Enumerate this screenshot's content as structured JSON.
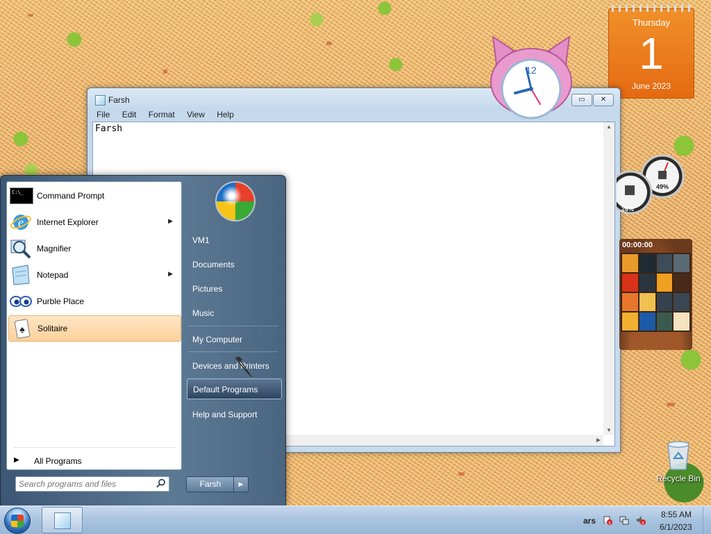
{
  "notepad": {
    "title": "Farsh",
    "menu": [
      "File",
      "Edit",
      "Format",
      "View",
      "Help"
    ],
    "content": "Farsh"
  },
  "start_menu": {
    "programs": [
      {
        "label": "Command Prompt",
        "icon": "command-prompt-icon",
        "has_submenu": false
      },
      {
        "label": "Internet Explorer",
        "icon": "internet-explorer-icon",
        "has_submenu": true
      },
      {
        "label": "Magnifier",
        "icon": "magnifier-icon",
        "has_submenu": false
      },
      {
        "label": "Notepad",
        "icon": "notepad-icon",
        "has_submenu": true
      },
      {
        "label": "Purble Place",
        "icon": "purble-place-icon",
        "has_submenu": false
      },
      {
        "label": "Solitaire",
        "icon": "solitaire-icon",
        "has_submenu": false,
        "selected": true
      }
    ],
    "all_programs": "All Programs",
    "search_placeholder": "Search programs and files",
    "right_links": [
      {
        "label": "VM1"
      },
      {
        "label": "Documents"
      },
      {
        "label": "Pictures"
      },
      {
        "label": "Music"
      },
      {
        "label": "My Computer"
      },
      {
        "label": "Devices and Printers"
      },
      {
        "label": "Default Programs",
        "highlighted": true
      },
      {
        "label": "Help and Support"
      }
    ],
    "shutdown_label": "Farsh"
  },
  "taskbar": {
    "tray_label": "ars",
    "time": "8:55 AM",
    "date": "6/1/2023"
  },
  "gadgets": {
    "calendar": {
      "weekday": "Thursday",
      "day": "1",
      "month_year": "June 2023"
    },
    "clock": {
      "number": "12"
    },
    "meter": {
      "cpu": "26%",
      "memory": "49%"
    },
    "puzzle": {
      "timer": "00:00:00"
    }
  },
  "desktop": {
    "recycle_bin": "Recycle Bin"
  },
  "colors": {
    "start_menu_accent": "#3c5774",
    "selected_item": "#fbd19b",
    "calendar_orange": "#e56a12"
  }
}
